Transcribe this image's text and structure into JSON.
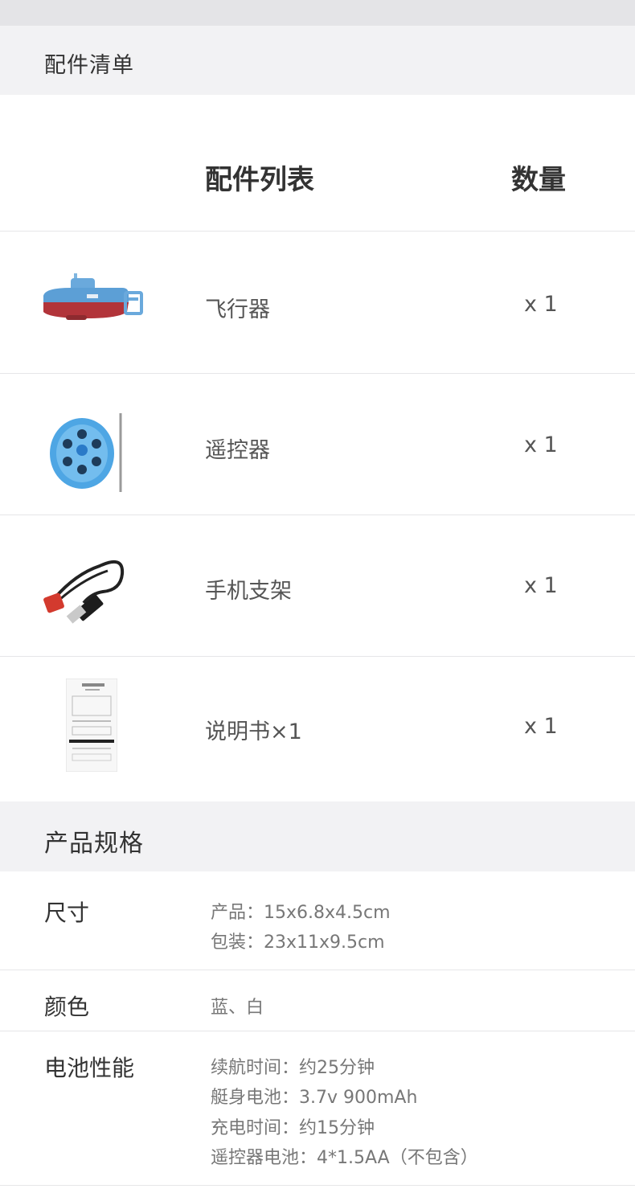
{
  "accessories_section": {
    "title": "配件清单"
  },
  "accessory_table": {
    "col_name": "配件列表",
    "col_qty": "数量",
    "items": [
      {
        "name": "飞行器",
        "qty": "x 1",
        "icon": "submarine-icon"
      },
      {
        "name": "遥控器",
        "qty": "x 1",
        "icon": "remote-control-icon"
      },
      {
        "name": "手机支架",
        "qty": "x 1",
        "icon": "usb-cable-icon"
      },
      {
        "name": "说明书×1",
        "qty": "x 1",
        "icon": "manual-icon"
      }
    ]
  },
  "specs_section": {
    "title": "产品规格"
  },
  "specs": [
    {
      "label": "尺寸",
      "lines": [
        "产品：15x6.8x4.5cm",
        "包装：23x11x9.5cm"
      ]
    },
    {
      "label": "颜色",
      "lines": [
        "蓝、白"
      ]
    },
    {
      "label": "电池性能",
      "lines": [
        "续航时间：约25分钟",
        "艇身电池：3.7v 900mAh",
        "充电时间：约15分钟",
        "遥控器电池：4*1.5AA（不包含）"
      ]
    }
  ],
  "colors": {
    "header_bg": "#f2f2f4",
    "accent_blue": "#5aa8e6",
    "hull_red": "#b2343a"
  }
}
